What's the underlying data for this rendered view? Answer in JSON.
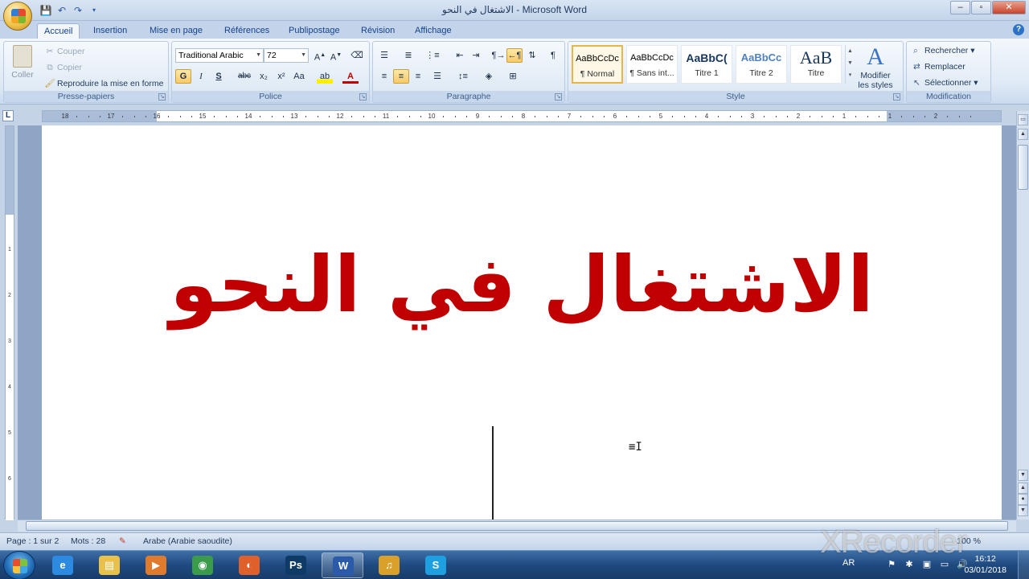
{
  "window": {
    "title": "الاشتغال في النحو - Microsoft Word"
  },
  "tabs": [
    "Accueil",
    "Insertion",
    "Mise en page",
    "Références",
    "Publipostage",
    "Révision",
    "Affichage"
  ],
  "clipboard": {
    "paste": "Coller",
    "cut": "Couper",
    "copy": "Copier",
    "format_painter": "Reproduire la mise en forme",
    "label": "Presse-papiers"
  },
  "font": {
    "family": "Traditional Arabic",
    "size": "72",
    "label": "Police",
    "bold": "G",
    "italic": "I",
    "underline": "S",
    "strike": "abc",
    "subscript": "x₂",
    "superscript": "x²",
    "case": "Aa"
  },
  "paragraph": {
    "label": "Paragraphe"
  },
  "styles": {
    "label": "Style",
    "items": [
      {
        "sample": "AaBbCcDc",
        "name": "¶ Normal"
      },
      {
        "sample": "AaBbCcDc",
        "name": "¶ Sans int..."
      },
      {
        "sample": "AaBbC(",
        "name": "Titre 1"
      },
      {
        "sample": "AaBbCc",
        "name": "Titre 2"
      },
      {
        "sample": "AaB",
        "name": "Titre"
      }
    ],
    "modify_line1": "Modifier",
    "modify_line2": "les styles"
  },
  "editing": {
    "label": "Modification",
    "find": "Rechercher",
    "replace": "Remplacer",
    "select": "Sélectionner"
  },
  "ruler": {
    "corner": "L",
    "ticks": [
      "18",
      "17",
      "16",
      "15",
      "14",
      "13",
      "12",
      "11",
      "10",
      "9",
      "8",
      "7",
      "6",
      "5",
      "4",
      "3",
      "2",
      "1",
      "1",
      "2"
    ],
    "vticks": [
      "1",
      "2",
      "3",
      "4",
      "5",
      "6"
    ]
  },
  "document": {
    "heading": "الاشتغال في النحو",
    "heading_color": "#c00000"
  },
  "status": {
    "page": "Page : 1 sur 2",
    "words": "Mots : 28",
    "language": "Arabe (Arabie saoudite)",
    "zoom": "100 %"
  },
  "taskbar": {
    "apps": [
      {
        "icon": "ie-icon",
        "glyph": "e",
        "color": "#2c8be0"
      },
      {
        "icon": "explorer-icon",
        "glyph": "▤",
        "color": "#e9c04a"
      },
      {
        "icon": "media-player-icon",
        "glyph": "▶",
        "color": "#e07a2c"
      },
      {
        "icon": "chrome-icon",
        "glyph": "◉",
        "color": "#3a9c4a"
      },
      {
        "icon": "firefox-icon",
        "glyph": "◐",
        "color": "#e0602c"
      },
      {
        "icon": "photoshop-icon",
        "glyph": "Ps",
        "color": "#0d3b66"
      },
      {
        "icon": "word-icon",
        "glyph": "W",
        "color": "#2b5aa8"
      },
      {
        "icon": "audio-icon",
        "glyph": "♫",
        "color": "#d9a12a"
      },
      {
        "icon": "skype-icon",
        "glyph": "S",
        "color": "#1ea0e0"
      }
    ],
    "language": "AR",
    "time": "16:12",
    "date": "03/01/2018"
  },
  "watermark": "XRecorder"
}
